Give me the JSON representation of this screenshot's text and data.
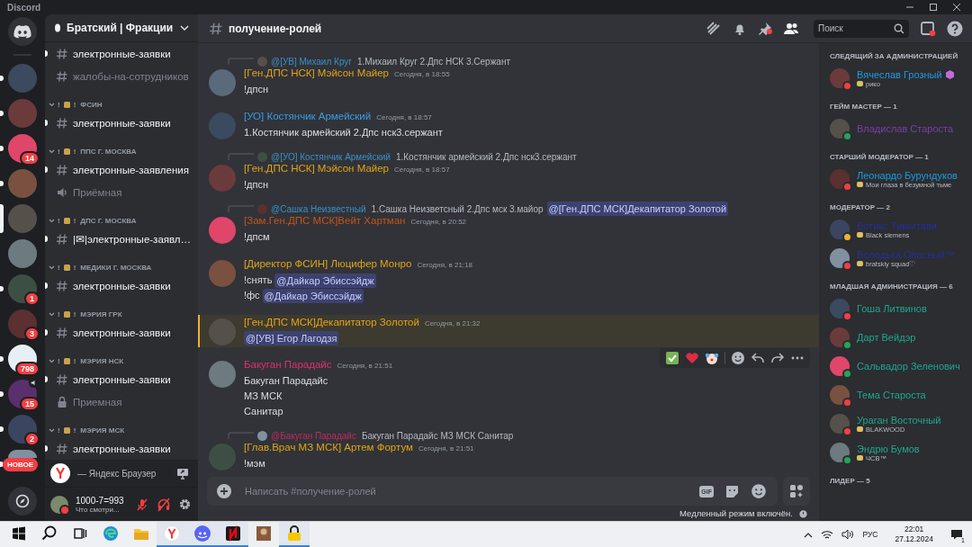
{
  "window": {
    "title": "Discord"
  },
  "servers": [
    {
      "kind": "home",
      "selected": false,
      "unread": false
    },
    {
      "kind": "avatar",
      "selected": false,
      "unread": true
    },
    {
      "kind": "avatar",
      "selected": false,
      "unread": true
    },
    {
      "kind": "avatar",
      "selected": false,
      "unread": true,
      "badge": "14"
    },
    {
      "kind": "avatar",
      "selected": false,
      "unread": true
    },
    {
      "kind": "avatar",
      "selected": true,
      "unread": false
    },
    {
      "kind": "avatar",
      "selected": false,
      "unread": false
    },
    {
      "kind": "avatar",
      "selected": false,
      "unread": true,
      "badge": "1"
    },
    {
      "kind": "avatar",
      "selected": false,
      "unread": false,
      "badge": "3"
    },
    {
      "kind": "avatar",
      "selected": false,
      "unread": true,
      "badge": "798"
    },
    {
      "kind": "avatar",
      "selected": false,
      "unread": true,
      "badge": "15",
      "voice": true
    },
    {
      "kind": "avatar",
      "selected": false,
      "unread": true,
      "badge": "2"
    },
    {
      "kind": "avatar",
      "selected": false,
      "unread": true,
      "pill": "НОВОЕ"
    },
    {
      "kind": "explore",
      "selected": false,
      "unread": false
    }
  ],
  "server_name": "Братский | Фракции",
  "channels": [
    {
      "kind": "text",
      "name": "электронные-заявки",
      "unread": true
    },
    {
      "kind": "text",
      "name": "жалобы-на-сотрудников",
      "unread": false
    },
    {
      "kind": "category",
      "lead": "!",
      "trail": "!",
      "name": "ФСИН",
      "children": [
        {
          "kind": "text",
          "name": "электронные-заявки",
          "unread": true
        }
      ]
    },
    {
      "kind": "category",
      "lead": "!",
      "trail": "!",
      "name": "ППС Г. МОСКВА",
      "children": [
        {
          "kind": "text",
          "name": "электронные-заявления",
          "unread": true
        },
        {
          "kind": "voice",
          "name": "Приёмная",
          "unread": false
        }
      ]
    },
    {
      "kind": "category",
      "lead": "!",
      "trail": "!",
      "name": "ДПС Г. МОСКВА",
      "children": [
        {
          "kind": "text",
          "name": "|✉|электронные-заявл…",
          "unread": true
        }
      ]
    },
    {
      "kind": "category",
      "lead": "!",
      "trail": "!",
      "name": "МЕДИКИ Г. МОСКВА",
      "children": [
        {
          "kind": "text",
          "name": "электронные-заявки",
          "unread": true
        }
      ]
    },
    {
      "kind": "category",
      "lead": "!",
      "trail": "!",
      "name": "МЭРИЯ ГРК",
      "children": [
        {
          "kind": "text",
          "name": "электронные-заявки",
          "unread": true
        }
      ]
    },
    {
      "kind": "category",
      "lead": "!",
      "trail": "!",
      "name": "МЭРИЯ НСК",
      "children": [
        {
          "kind": "text",
          "name": "электронные-заявки",
          "unread": true
        },
        {
          "kind": "locked",
          "name": "Приемная",
          "unread": false
        }
      ]
    },
    {
      "kind": "category",
      "lead": "!",
      "trail": "!",
      "name": "МЭРИЯ МСК",
      "children": [
        {
          "kind": "text",
          "name": "электронные-заявки",
          "unread": true
        }
      ]
    }
  ],
  "activity": {
    "text": "— Яндекс Браузер"
  },
  "user": {
    "name": "1000-7=993",
    "status": "Что смотри...",
    "muted": true,
    "deafened": true
  },
  "channel_title": "получение-ролей",
  "search": {
    "placeholder": "Поиск"
  },
  "messages": [
    {
      "reply": {
        "name": "@[УВ] Михаил Круг",
        "color": "#3a8fc7",
        "text": "1.Михаил Круг 2.Дпс НСК 3.Сержант"
      },
      "author": "[Ген.ДПС НСК] Мэйсон Майер",
      "color": "#e2a416",
      "time": "Сегодня, в 18:55",
      "lines": [
        {
          "text": "!дпсн"
        }
      ],
      "highlighted": false
    },
    {
      "author": "[УО] Костянчик Армейский",
      "color": "#3a9be0",
      "time": "Сегодня, в 18:57",
      "lines": [
        {
          "text": "1.Костянчик армейский 2.Дпс нск3.сержант"
        }
      ],
      "highlighted": false
    },
    {
      "reply": {
        "name": "@[УО] Костянчик Армейский",
        "color": "#3a8fc7",
        "text": "1.Костянчик армейский 2.Дпс нск3.сержант"
      },
      "author": "[Ген.ДПС НСК] Мэйсон Майер",
      "color": "#e2a416",
      "time": "Сегодня, в 18:57",
      "lines": [
        {
          "text": "!дпсн"
        }
      ],
      "highlighted": false
    },
    {
      "reply": {
        "name": "@Сашка Неизвестный",
        "color": "#3a8fc7",
        "text": "1.Сашка Неизветсный  2.Дпс мск 3.майор",
        "mention": "@[Ген.ДПС МСК]Декапитатор Золотой"
      },
      "author": "[Зам.Ген.ДПС МСК]Вейт Хартман",
      "color": "#c4541c",
      "time": "Сегодня, в 20:52",
      "lines": [
        {
          "text": "!дпсм"
        }
      ],
      "highlighted": false
    },
    {
      "author": "[Директор ФСИН] Люцифер Монро",
      "color": "#e2a416",
      "time": "Сегодня, в 21:18",
      "lines": [
        {
          "text": "!снять",
          "mention": "@Дайкар Эбиссэйдж"
        },
        {
          "text": "!фс",
          "mention": "@Дайкар Эбиссэйдж"
        }
      ],
      "highlighted": false
    },
    {
      "author": "[Ген.ДПС МСК]Декапитатор Золотой",
      "color": "#e2a416",
      "time": "Сегодня, в 21:32",
      "lines": [
        {
          "mention": "@[УВ] Егор Лагодзя"
        }
      ],
      "highlighted": true
    },
    {
      "author": "Бакуган Парадайс",
      "color": "#e0306f",
      "time": "Сегодня, в 21:51",
      "lines": [
        {
          "text": "Бакуган Парадайс"
        },
        {
          "text": "МЗ МСК"
        },
        {
          "text": "Санитар"
        }
      ],
      "highlighted": false,
      "hovered": true
    },
    {
      "reply": {
        "name": "@Бакуган Парадайс",
        "color": "#c02a62",
        "text": "Бакуган Парадайс  МЗ МСК  Санитар"
      },
      "author": "[Глав.Врач МЗ МСК] Артем Фортум",
      "color": "#e2a416",
      "time": "Сегодня, в 21:51",
      "lines": [
        {
          "text": "!мэм"
        }
      ],
      "highlighted": false
    }
  ],
  "composer": {
    "placeholder": "Написать #получение-ролей",
    "gif_label": "GIF"
  },
  "slow_mode": "Медленный режим включён.",
  "member_groups": [
    {
      "title": "СЛЕДЯЩИЙ ЗА АДМИНИСТРАЦИЕЙ",
      "members": [
        {
          "name": "Вячеслав Грозный",
          "color": "#1e9be0",
          "kind": "dnd",
          "activity": "рико",
          "badge": true
        }
      ]
    },
    {
      "title": "ГЕЙМ МАСТЕР — 1",
      "members": [
        {
          "name": "Владислав Староста",
          "color": "#7b3fa8",
          "kind": "online",
          "badge": false
        }
      ]
    },
    {
      "title": "СТАРШИЙ МОДЕРАТОР — 1",
      "members": [
        {
          "name": "Леонардо Бурундуков",
          "color": "#1e9be0",
          "kind": "dnd",
          "activity": "Мои глаза в безумной тьме",
          "badge": false
        }
      ]
    },
    {
      "title": "МОДЕРАТОР — 2",
      "members": [
        {
          "name": "Ботикс Тиккитави",
          "color": "#24309a",
          "kind": "idle",
          "activity": "Black siemens",
          "badge": false
        },
        {
          "name": "Володька Опасный™",
          "color": "#24309a",
          "kind": "dnd",
          "activity": "bratskiy squad♡",
          "badge": false
        }
      ]
    },
    {
      "title": "МЛАДШАЯ АДМИНИСТРАЦИЯ — 6",
      "members": [
        {
          "name": "Гоша Литвинов",
          "color": "#1fa68f",
          "kind": "dnd",
          "badge": false
        },
        {
          "name": "Дарт Вейдэр",
          "color": "#1fa68f",
          "kind": "online",
          "badge": false
        },
        {
          "name": "Сальвадор Зеленович",
          "color": "#1fa68f",
          "kind": "online",
          "badge": false
        },
        {
          "name": "Тема Староста",
          "color": "#1fa68f",
          "kind": "dnd",
          "badge": false
        },
        {
          "name": "Ураган Восточный",
          "color": "#1fa68f",
          "kind": "dnd",
          "activity": "BLAKWOOD",
          "badge": false
        },
        {
          "name": "Эндрю Бумов",
          "color": "#1fa68f",
          "kind": "online",
          "activity": "ЧСВ™",
          "badge": false
        }
      ]
    },
    {
      "title": "ЛИДЕР — 5"
    }
  ],
  "taskbar": {
    "items": [
      {
        "kind": "start",
        "active": false
      },
      {
        "kind": "search",
        "active": false
      },
      {
        "kind": "taskview",
        "active": false
      },
      {
        "kind": "browser",
        "active": false
      },
      {
        "kind": "folder",
        "active": false
      },
      {
        "kind": "yandex",
        "active": true
      },
      {
        "kind": "discord",
        "active": true
      },
      {
        "kind": "letter-app",
        "active": true
      },
      {
        "kind": "picture-app",
        "active": false
      },
      {
        "kind": "lock-app",
        "active": true
      }
    ],
    "language": "РУС",
    "time": "22:01",
    "date": "27.12.2024",
    "notifications": "1"
  }
}
